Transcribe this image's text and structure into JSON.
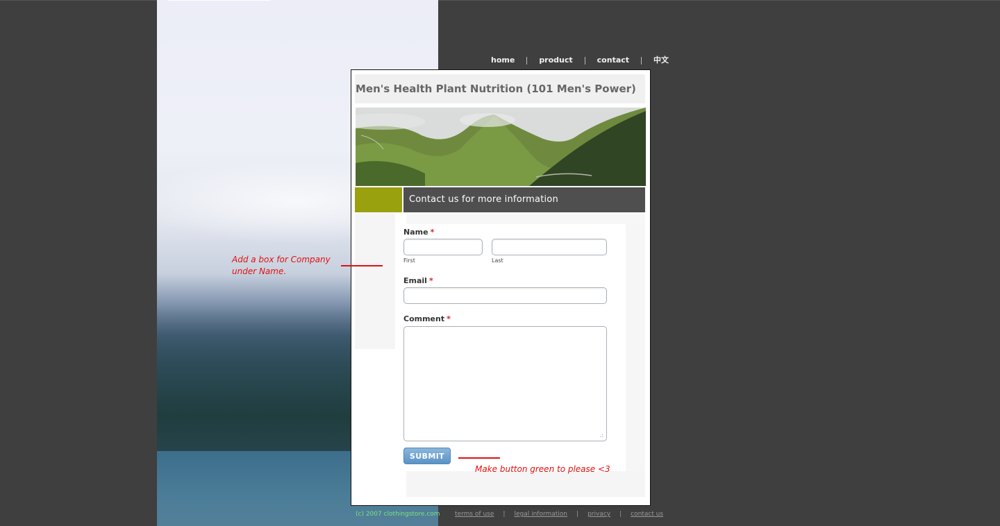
{
  "nav": {
    "items": [
      "home",
      "product",
      "contact",
      "中文"
    ]
  },
  "page": {
    "title": "Men's Health Plant Nutrition (101 Men's Power)",
    "contact_heading": "Contact us for more information"
  },
  "form": {
    "name_label": "Name",
    "required_mark": "*",
    "first_sublabel": "First",
    "last_sublabel": "Last",
    "email_label": "Email",
    "comment_label": "Comment",
    "first_value": "",
    "last_value": "",
    "email_value": "",
    "comment_value": "",
    "submit_label": "SUBMIT",
    "resize_grip": ".:"
  },
  "footer": {
    "copyright": "(c) 2007 clothingstore.com",
    "links": [
      "terms of use",
      "legal information",
      "privacy",
      "contact us"
    ],
    "separator": "|"
  },
  "annotations": {
    "company_note_line1": "Add a box for Company",
    "company_note_line2": "under Name.",
    "button_note": "Make button green to please <3"
  },
  "colors": {
    "background": "#3f3f3f",
    "accent_olive": "#9aa10f",
    "contact_bar": "#4f4f4f",
    "annotation_red": "#e01010",
    "submit_blue": "#5b93c6",
    "footer_green": "#7ee07e"
  }
}
